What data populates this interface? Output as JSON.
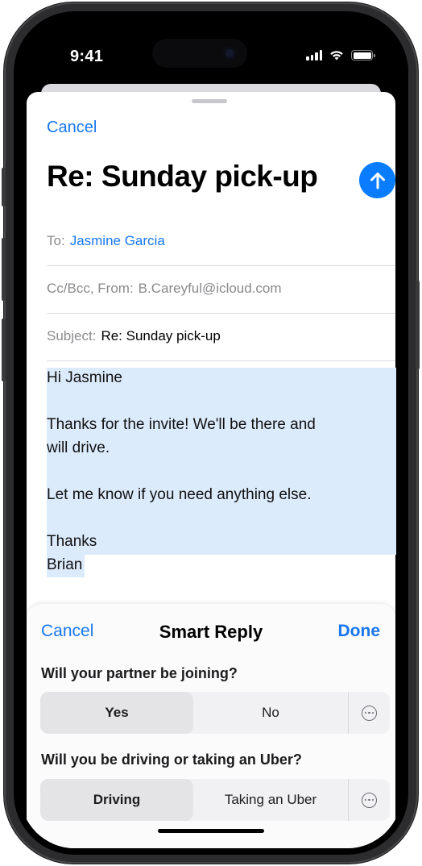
{
  "status_bar": {
    "time": "9:41"
  },
  "compose": {
    "cancel_label": "Cancel",
    "title": "Re: Sunday pick-up",
    "to_label": "To:",
    "to_value": "Jasmine Garcia",
    "ccbcc_label": "Cc/Bcc, From:",
    "from_value": "B.Careyful@icloud.com",
    "subject_label": "Subject:",
    "subject_value": "Re: Sunday pick-up",
    "body_lines": [
      "Hi Jasmine",
      "Thanks for the invite! We'll be there and",
      "will drive.",
      "Let me know if you need anything else.",
      "Thanks",
      "Brian"
    ]
  },
  "smart_reply": {
    "cancel_label": "Cancel",
    "title": "Smart Reply",
    "done_label": "Done",
    "questions": [
      {
        "text": "Will your partner be joining?",
        "options": [
          "Yes",
          "No"
        ],
        "selected": "Yes"
      },
      {
        "text": "Will you be driving or taking an Uber?",
        "options": [
          "Driving",
          "Taking an Uber"
        ],
        "selected": "Driving"
      }
    ]
  },
  "colors": {
    "accent": "#1877ee",
    "send_button": "#0a7cff",
    "highlight": "#dcebfc"
  },
  "icons": [
    "send-arrow-up-icon",
    "more-options-icon",
    "cellular-signal-icon",
    "wifi-icon",
    "battery-icon"
  ]
}
